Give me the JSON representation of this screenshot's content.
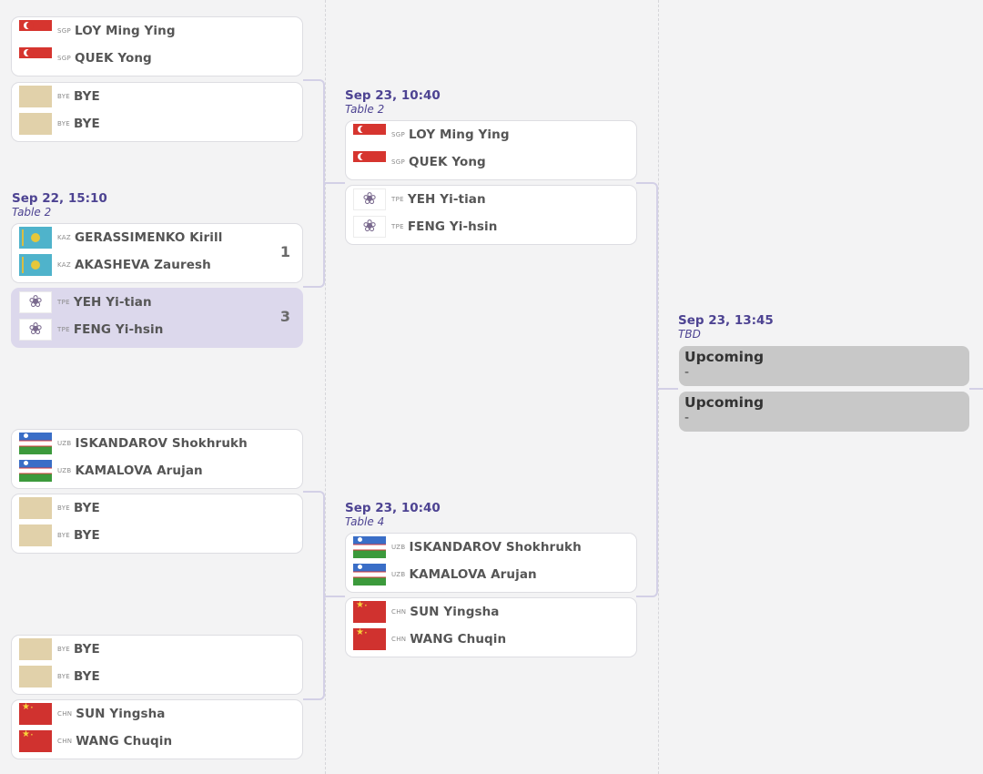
{
  "round1": {
    "m1": {
      "p1": {
        "code": "SGP",
        "name": "LOY Ming Ying",
        "flag": "sgp-flag-icon"
      },
      "p2": {
        "code": "SGP",
        "name": "QUEK Yong",
        "flag": "sgp-flag-icon"
      }
    },
    "m2": {
      "p1": {
        "code": "BYE",
        "name": "BYE",
        "flag": "bye-placeholder-icon"
      },
      "p2": {
        "code": "BYE",
        "name": "BYE",
        "flag": "bye-placeholder-icon"
      }
    },
    "m3": {
      "date": "Sep 22, 15:10",
      "table": "Table 2",
      "p1": {
        "code": "KAZ",
        "name": "GERASSIMENKO Kirill",
        "flag": "kaz-flag-icon"
      },
      "p2": {
        "code": "KAZ",
        "name": "AKASHEVA Zauresh",
        "flag": "kaz-flag-icon"
      },
      "score": "1"
    },
    "m4": {
      "p1": {
        "code": "TPE",
        "name": "YEH Yi-tian",
        "flag": "tpe-flag-icon"
      },
      "p2": {
        "code": "TPE",
        "name": "FENG Yi-hsin",
        "flag": "tpe-flag-icon"
      },
      "score": "3"
    },
    "m5": {
      "p1": {
        "code": "UZB",
        "name": "ISKANDAROV Shokhrukh",
        "flag": "uzb-flag-icon"
      },
      "p2": {
        "code": "UZB",
        "name": "KAMALOVA Arujan",
        "flag": "uzb-flag-icon"
      }
    },
    "m6": {
      "p1": {
        "code": "BYE",
        "name": "BYE",
        "flag": "bye-placeholder-icon"
      },
      "p2": {
        "code": "BYE",
        "name": "BYE",
        "flag": "bye-placeholder-icon"
      }
    },
    "m7": {
      "p1": {
        "code": "BYE",
        "name": "BYE",
        "flag": "bye-placeholder-icon"
      },
      "p2": {
        "code": "BYE",
        "name": "BYE",
        "flag": "bye-placeholder-icon"
      }
    },
    "m8": {
      "p1": {
        "code": "CHN",
        "name": "SUN Yingsha",
        "flag": "chn-flag-icon"
      },
      "p2": {
        "code": "CHN",
        "name": "WANG Chuqin",
        "flag": "chn-flag-icon"
      }
    }
  },
  "round2": {
    "top": {
      "date": "Sep 23, 10:40",
      "table": "Table 2",
      "m1": {
        "p1": {
          "code": "SGP",
          "name": "LOY Ming Ying",
          "flag": "sgp-flag-icon"
        },
        "p2": {
          "code": "SGP",
          "name": "QUEK Yong",
          "flag": "sgp-flag-icon"
        }
      },
      "m2": {
        "p1": {
          "code": "TPE",
          "name": "YEH Yi-tian",
          "flag": "tpe-flag-icon"
        },
        "p2": {
          "code": "TPE",
          "name": "FENG Yi-hsin",
          "flag": "tpe-flag-icon"
        }
      }
    },
    "bottom": {
      "date": "Sep 23, 10:40",
      "table": "Table 4",
      "m1": {
        "p1": {
          "code": "UZB",
          "name": "ISKANDAROV Shokhrukh",
          "flag": "uzb-flag-icon"
        },
        "p2": {
          "code": "UZB",
          "name": "KAMALOVA Arujan",
          "flag": "uzb-flag-icon"
        }
      },
      "m2": {
        "p1": {
          "code": "CHN",
          "name": "SUN Yingsha",
          "flag": "chn-flag-icon"
        },
        "p2": {
          "code": "CHN",
          "name": "WANG Chuqin",
          "flag": "chn-flag-icon"
        }
      }
    }
  },
  "round3": {
    "date": "Sep 23, 13:45",
    "table": "TBD",
    "slot1": {
      "title": "Upcoming",
      "sub": "-"
    },
    "slot2": {
      "title": "Upcoming",
      "sub": "-"
    }
  },
  "colors": {
    "accent": "#4d4392",
    "winner_bg": "#dcd8ec",
    "upcoming_bg": "#c8c8c8",
    "connector": "#d3d0e6"
  }
}
